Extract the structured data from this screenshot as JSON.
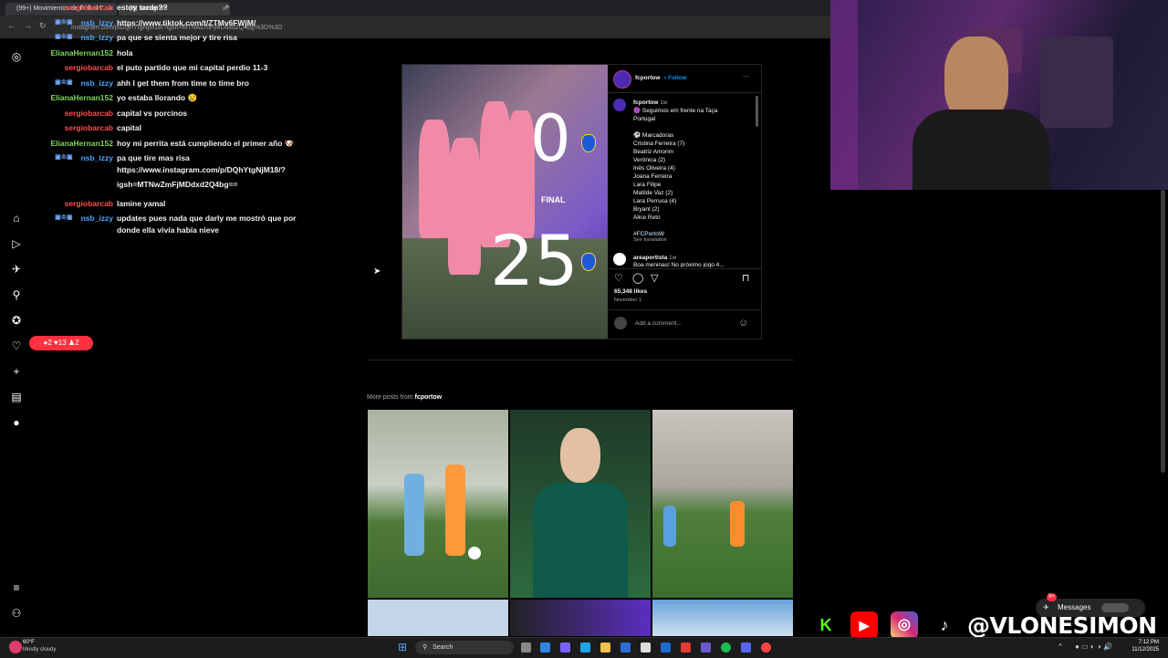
{
  "browser": {
    "tabs": [
      {
        "label": "(99+) Movimientos de Fútbol C..."
      },
      {
        "label": "(9) Instagram"
      }
    ],
    "new_tab": "+",
    "url": "instagram.com/p/DQhYtgNjM18/?igsh=MTNwZmFjMDdxd2Q4bg%3D%3D"
  },
  "chat": [
    {
      "user": "sergiobarcab",
      "text": "estoy tarde??",
      "color": "red"
    },
    {
      "user": "nsb_izzy",
      "text": "https://www.tiktok.com/t/ZTMv6FWjM/",
      "color": "blue",
      "badges": true
    },
    {
      "user": "nsb_izzy",
      "text": "pa que se sienta mejor y tire risa",
      "color": "blue",
      "badges": true
    },
    {
      "user": "ElianaHernan152",
      "text": "hola",
      "color": "green"
    },
    {
      "user": "sergiobarcab",
      "text": "el puto partido que mi capital perdio 11-3",
      "color": "red"
    },
    {
      "user": "nsb_izzy",
      "text": "ahh I get them from time to time bro",
      "color": "blue",
      "badges": true
    },
    {
      "user": "ElianaHernan152",
      "text": "yo estaba llorando 😢",
      "color": "green"
    },
    {
      "user": "sergiobarcab",
      "text": "capital vs porcinos",
      "color": "red"
    },
    {
      "user": "sergiobarcab",
      "text": "capital",
      "color": "red"
    },
    {
      "user": "ElianaHernan152",
      "text": "hoy mi perrita está cumpliendo el primer año 🐶",
      "color": "green"
    },
    {
      "user": "nsb_izzy",
      "text": "pa que tire mas risa",
      "color": "blue",
      "badges": true
    },
    {
      "user": "",
      "text": "https://www.instagram.com/p/DQhYtgNjM18/?",
      "color": "blue"
    },
    {
      "user": "",
      "text": "igsh=MTNwZmFjMDdxd2Q4bg==",
      "color": "blue"
    },
    {
      "user": "sergiobarcab",
      "text": "lamine yamal",
      "color": "red"
    },
    {
      "user": "nsb_izzy",
      "text": "updates pues nada que darly me mostró que por",
      "color": "blue",
      "badges": true
    },
    {
      "user": "",
      "text": "donde ella vivía había nieve",
      "color": "blue"
    }
  ],
  "notifications": {
    "comments": "2",
    "likes": "13",
    "follows": "2"
  },
  "post": {
    "account": "fcportow",
    "follow": "Follow",
    "more": "···",
    "score_top": "0",
    "final": "FINAL",
    "score_bottom": "25",
    "caption_user": "fcportow",
    "caption_time": "1w",
    "caption_lines": [
      "🟣 Seguimos em frente na Taça",
      "Portugal",
      "",
      "⚽ Marcadoras",
      "Cristina Ferreira (7)",
      "Beatriz Amorim",
      "Verónica (2)",
      "Inês Oliveira (4)",
      "Joana Ferreira",
      "Lara Filipe",
      "Matilde Vaz (2)",
      "Lara Perruca (4)",
      "Bryant (2)",
      "Alice Reto",
      "",
      "#FCPortoW"
    ],
    "see_translation": "See translation",
    "comment_user": "areaportista",
    "comment_time": "1w",
    "comment_text": "Boa meninas! No próximo jogo 4...",
    "likes": "65,348 likes",
    "date": "November 1",
    "add_comment": "Add a comment..."
  },
  "more_posts": {
    "label": "More posts from",
    "account": "fcportow"
  },
  "socials": {
    "handle": "@VLONESIMON"
  },
  "messages": {
    "label": "Messages",
    "badge": "9+"
  },
  "taskbar": {
    "weather_temp": "60°F",
    "weather_desc": "Mostly cloudy",
    "search": "Search",
    "time": "7:12 PM",
    "date": "11/12/2025"
  }
}
